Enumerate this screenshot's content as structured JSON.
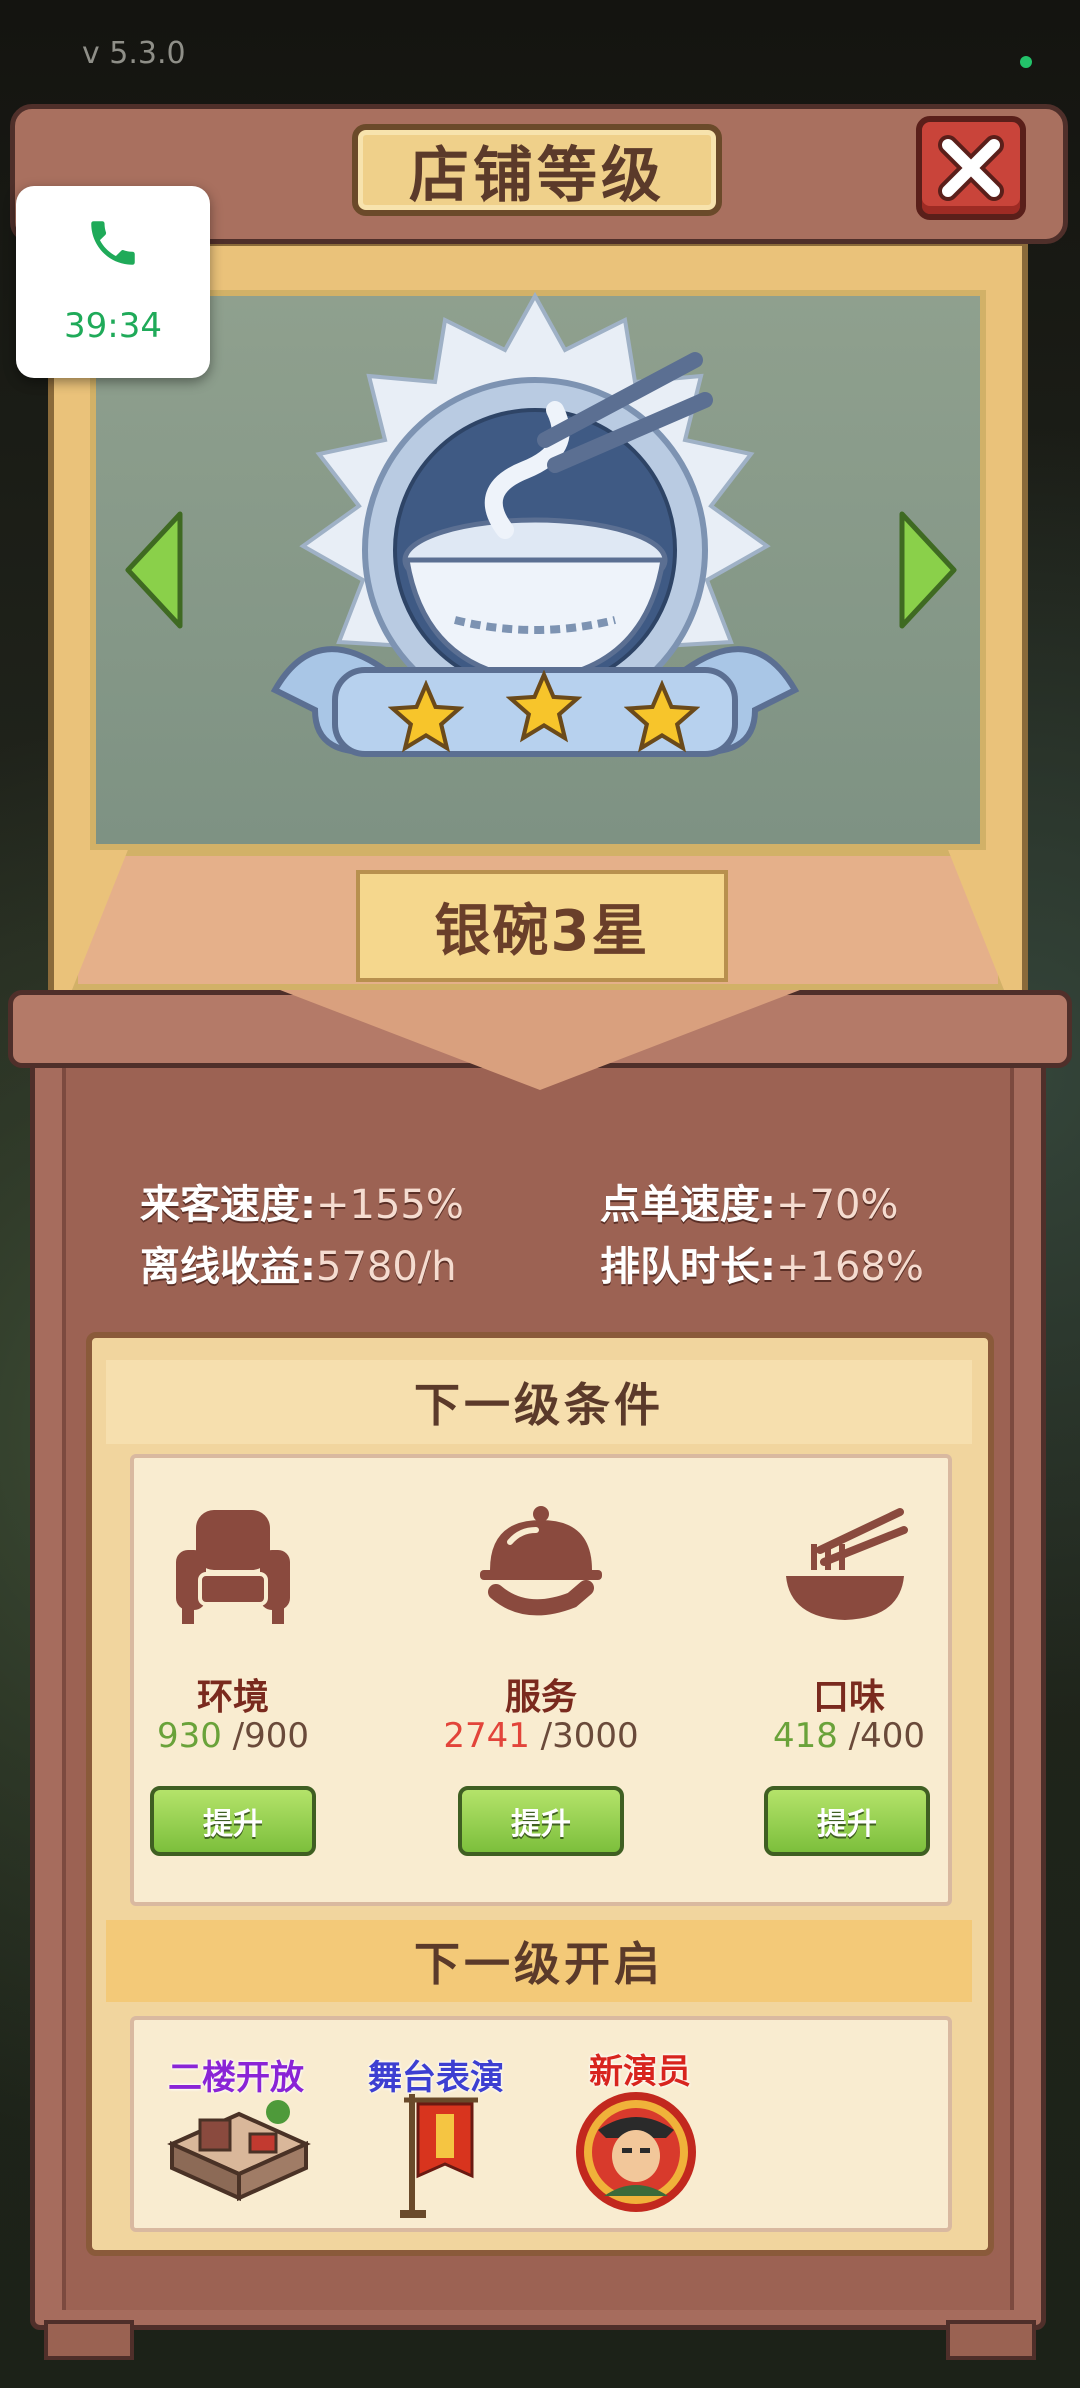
{
  "status_bar": {
    "version": "v  5.3.0"
  },
  "dialog": {
    "title": "店铺等级",
    "close_icon": "close-x-icon",
    "level_name": "银碗3星",
    "stars": 3,
    "medal_icon": "silver-bowl-medal-icon"
  },
  "stats": [
    {
      "label": "来客速度:",
      "value": "+155%"
    },
    {
      "label": "点单速度:",
      "value": "+70%"
    },
    {
      "label": "离线收益:",
      "value": "5780/h"
    },
    {
      "label": "排队时长:",
      "value": "+168%"
    }
  ],
  "next_conditions": {
    "heading": "下一级条件",
    "items": [
      {
        "name": "环境",
        "current": "930",
        "target": "/900",
        "status_color": "#6aa23a",
        "icon": "armchair-icon",
        "button": "提升"
      },
      {
        "name": "服务",
        "current": "2741",
        "target": "/3000",
        "status_color": "#e2443a",
        "icon": "serving-cloche-icon",
        "button": "提升"
      },
      {
        "name": "口味",
        "current": "418",
        "target": "/400",
        "status_color": "#6aa23a",
        "icon": "noodle-bowl-icon",
        "button": "提升"
      }
    ]
  },
  "next_unlocks": {
    "heading": "下一级开启",
    "items": [
      {
        "label": "二楼开放",
        "color": "#8a24d6",
        "icon": "second-floor-room-icon"
      },
      {
        "label": "舞台表演",
        "color": "#3d3fd1",
        "icon": "stage-banner-icon"
      },
      {
        "label": "新演员",
        "color": "#d8241e",
        "icon": "actor-portrait-icon"
      }
    ]
  },
  "call_widget": {
    "time": "39:34",
    "icon": "phone-icon"
  }
}
